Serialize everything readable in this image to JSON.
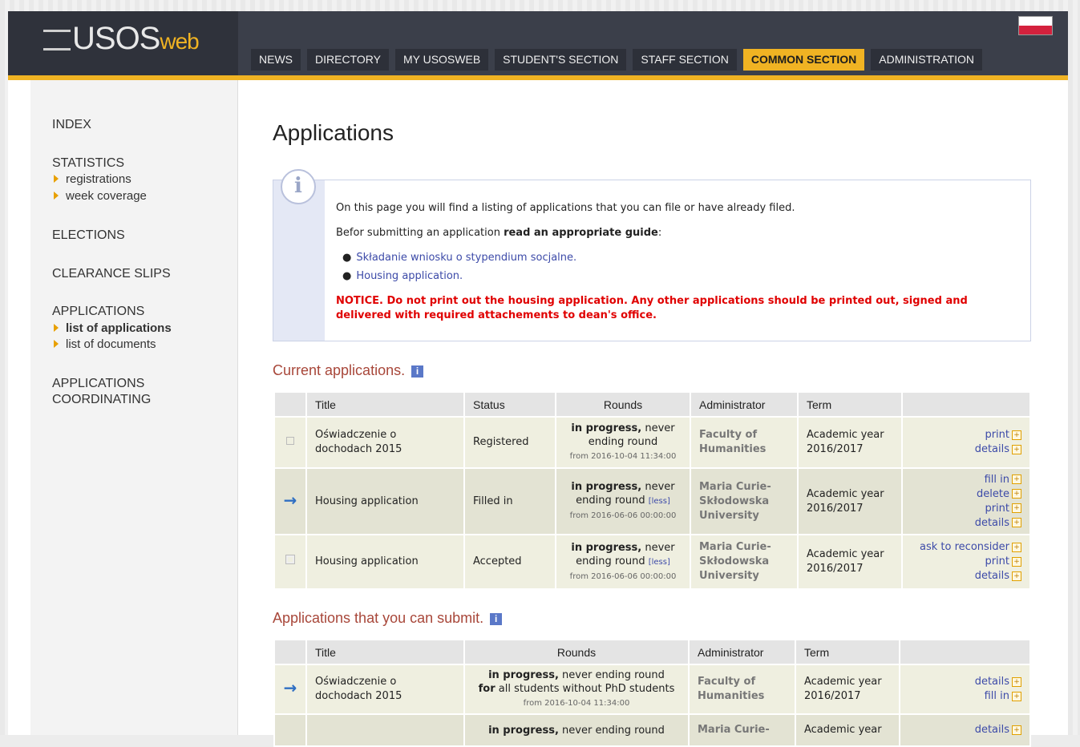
{
  "header": {
    "logo_main": "USOS",
    "logo_web": "web",
    "tabs": [
      {
        "label": "NEWS",
        "active": false
      },
      {
        "label": "DIRECTORY",
        "active": false
      },
      {
        "label": "MY USOSWEB",
        "active": false
      },
      {
        "label": "STUDENT'S SECTION",
        "active": false
      },
      {
        "label": "STAFF SECTION",
        "active": false
      },
      {
        "label": "COMMON SECTION",
        "active": true
      },
      {
        "label": "ADMINISTRATION",
        "active": false
      }
    ],
    "accent_color": "#f0b323"
  },
  "sidebar": {
    "index": "INDEX",
    "statistics": "STATISTICS",
    "stat_items": [
      "registrations",
      "week coverage"
    ],
    "elections": "ELECTIONS",
    "clearance": "CLEARANCE SLIPS",
    "applications": "APPLICATIONS",
    "app_items": [
      "list of applications",
      "list of documents"
    ],
    "coordinating_1": "APPLICATIONS",
    "coordinating_2": "COORDINATING"
  },
  "main": {
    "title": "Applications",
    "info": {
      "line1": "On this page you will find a listing of applications that you can file or have already filed.",
      "line2_a": "Befor submitting an application ",
      "line2_b": "read an appropriate guide",
      "line2_c": ":",
      "links": [
        "Składanie wniosku o stypendium socjalne.",
        "Housing application."
      ],
      "notice": "NOTICE. Do not print out the housing application. Any other applications should be printed out, signed and delivered with required attachements to dean's office."
    },
    "current": {
      "title": "Current applications.",
      "headers": [
        "Title",
        "Status",
        "Rounds",
        "Administrator",
        "Term"
      ],
      "rows": [
        {
          "title": "Oświadczenie o dochodach 2015",
          "status": "Registered",
          "round_bold": "in progress,",
          "round_text": " never ending round",
          "less": "",
          "from": "from 2016-10-04 11:34:00",
          "admin": "Faculty of Humanities",
          "term": "Academic year 2016/2017",
          "actions": [
            "print",
            "details"
          ]
        },
        {
          "title": "Housing application",
          "status": "Filled in",
          "round_bold": "in progress,",
          "round_text": " never ending round",
          "less": "[less]",
          "from": "from 2016-06-06 00:00:00",
          "admin": "Maria Curie-Skłodowska University",
          "term": "Academic year 2016/2017",
          "actions": [
            "fill in",
            "delete",
            "print",
            "details"
          ]
        },
        {
          "title": "Housing application",
          "status": "Accepted",
          "round_bold": "in progress,",
          "round_text": " never ending round",
          "less": "[less]",
          "from": "from 2016-06-06 00:00:00",
          "admin": "Maria Curie-Skłodowska University",
          "term": "Academic year 2016/2017",
          "actions": [
            "ask to reconsider",
            "print",
            "details"
          ]
        }
      ]
    },
    "submit": {
      "title": "Applications that you can submit.",
      "headers": [
        "Title",
        "Rounds",
        "Administrator",
        "Term"
      ],
      "rows": [
        {
          "title": "Oświadczenie o dochodach 2015",
          "round_bold": "in progress,",
          "round_text": " never ending round",
          "for_bold": "for",
          "for_text": " all students without PhD students",
          "from": "from 2016-10-04 11:34:00",
          "admin": "Faculty of Humanities",
          "term": "Academic year 2016/2017",
          "actions": [
            "details",
            "fill in"
          ]
        },
        {
          "round_bold": "in progress,",
          "round_text": " never ending round",
          "admin": "Maria Curie-",
          "term": "Academic year",
          "actions": [
            "details"
          ]
        }
      ]
    }
  }
}
